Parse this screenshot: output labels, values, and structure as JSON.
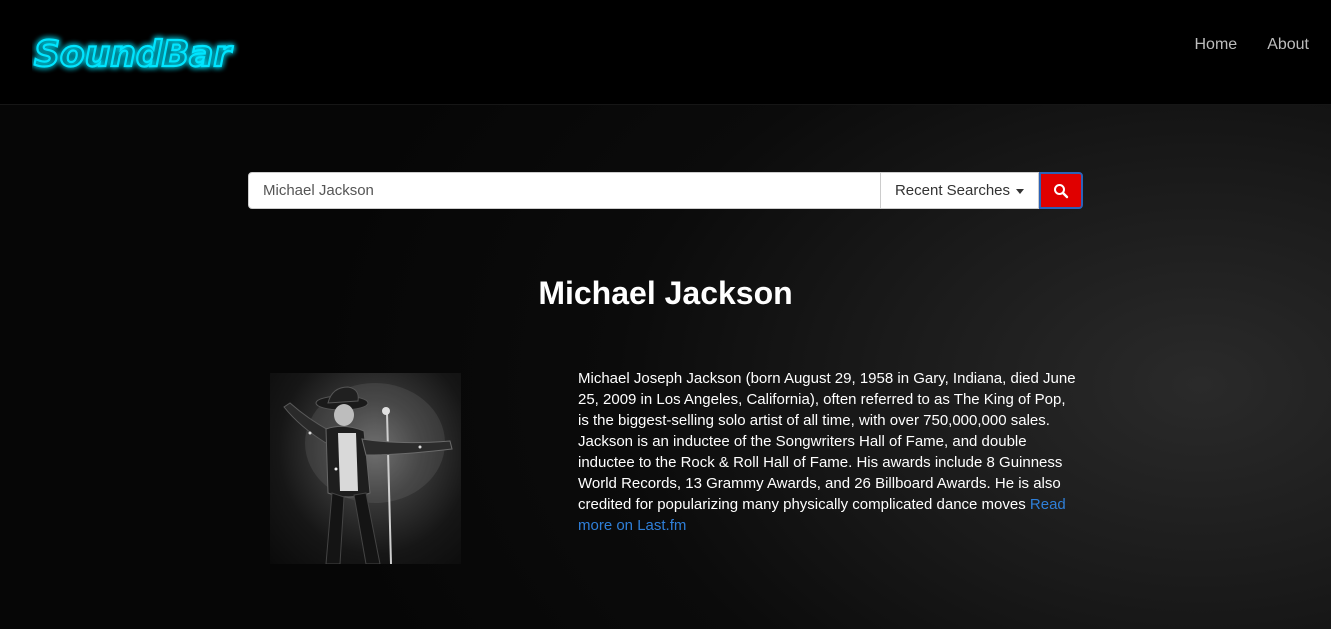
{
  "brand": {
    "logo_text": "SoundBar"
  },
  "nav": {
    "links": [
      {
        "label": "Home"
      },
      {
        "label": "About"
      }
    ]
  },
  "search": {
    "value": "Michael Jackson",
    "recent_label": "Recent Searches"
  },
  "artist": {
    "name": "Michael Jackson",
    "bio": "Michael Joseph Jackson (born August 29, 1958 in Gary, Indiana, died June 25, 2009 in Los Angeles, California), often referred to as The King of Pop, is the biggest-selling solo artist of all time, with over 750,000,000 sales. Jackson is an inductee of the Songwriters Hall of Fame, and double inductee to the Rock & Roll Hall of Fame. His awards include 8 Guinness World Records, 13 Grammy Awards, and 26 Billboard Awards. He is also credited for popularizing many physically complicated dance moves",
    "read_more": "Read more on Last.fm"
  },
  "colors": {
    "logo_glow": "#00e5ff",
    "search_button": "#e00000",
    "link": "#2f7fd8"
  },
  "icons": {
    "search_button": "search-icon",
    "recent_dropdown": "caret-down-icon"
  }
}
